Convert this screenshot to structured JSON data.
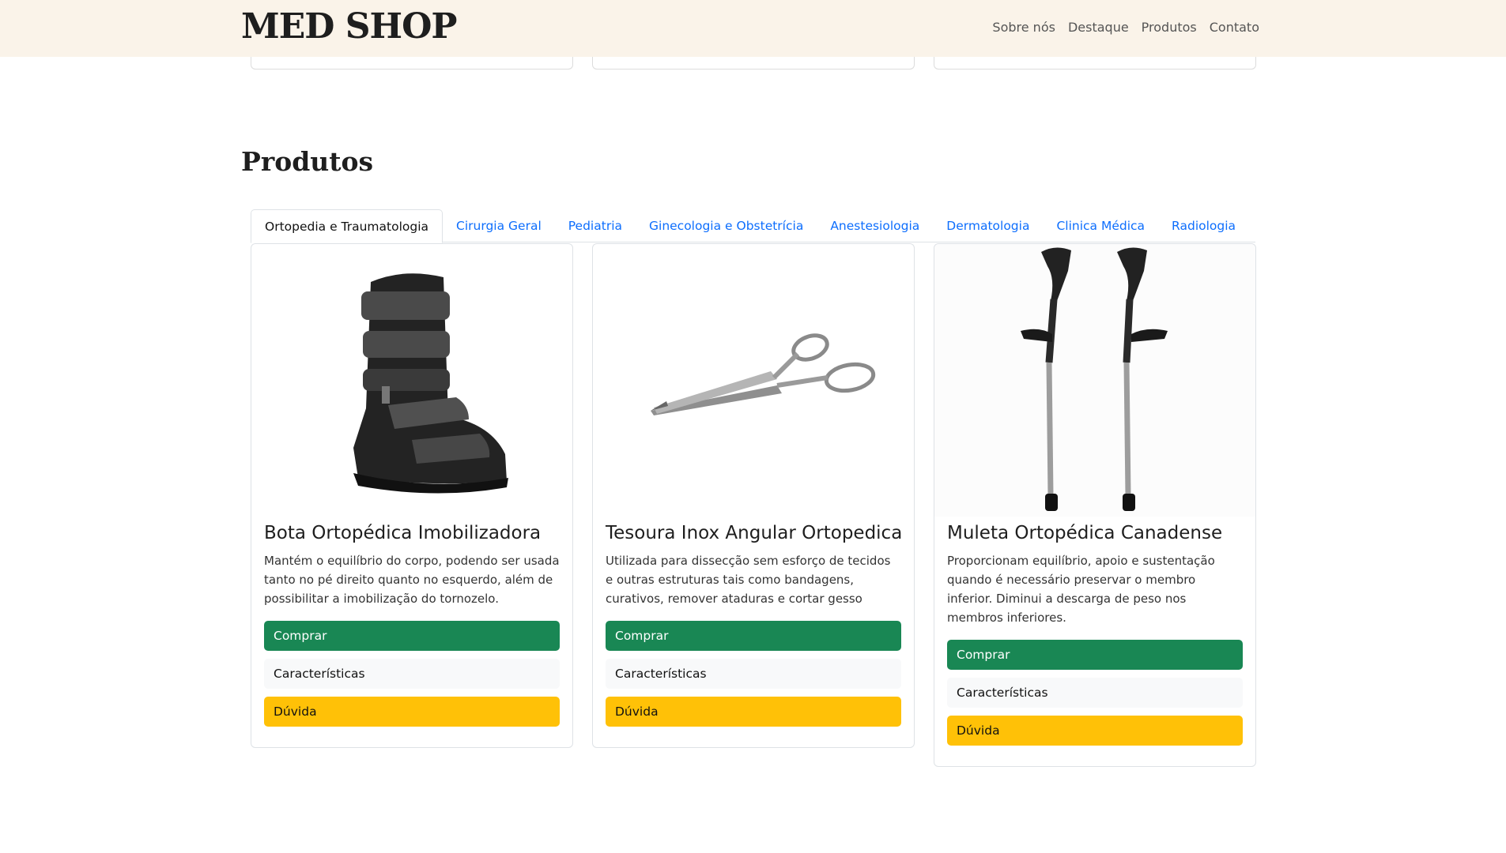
{
  "brand": "MED SHOP",
  "nav": [
    "Sobre nós",
    "Destaque",
    "Produtos",
    "Contato"
  ],
  "section_title": "Produtos",
  "tabs": [
    "Ortopedia e Traumatologia",
    "Cirurgia Geral",
    "Pediatria",
    "Ginecologia e Obstetrícia",
    "Anestesiologia",
    "Dermatologia",
    "Clinica Médica",
    "Radiologia"
  ],
  "active_tab": "Ortopedia e Traumatologia",
  "products": [
    {
      "title": "Bota Ortopédica Imobilizadora",
      "description": "Mantém o equilíbrio do corpo, podendo ser usada tanto no pé direito quanto no esquerdo, além de possibilitar a imobilização do tornozelo.",
      "buy": "Comprar",
      "features": "Características",
      "question": "Dúvida",
      "image_icon": "orthopedic-boot"
    },
    {
      "title": "Tesoura Inox Angular Ortopedica",
      "description": "Utilizada para dissecção sem esforço de tecidos e outras estruturas tais como bandagens, curativos, remover ataduras e cortar gesso",
      "buy": "Comprar",
      "features": "Características",
      "question": "Dúvida",
      "image_icon": "bandage-scissors"
    },
    {
      "title": "Muleta Ortopédica Canadense",
      "description": "Proporcionam equilíbrio, apoio e sustentação quando é necessário preservar o membro inferior. Diminui a descarga de peso nos membros inferiores.",
      "buy": "Comprar",
      "features": "Características",
      "question": "Dúvida",
      "image_icon": "forearm-crutches"
    }
  ],
  "colors": {
    "header_bg": "#faf3e9",
    "buy": "#198754",
    "question": "#ffc107",
    "link": "#0d6efd"
  }
}
